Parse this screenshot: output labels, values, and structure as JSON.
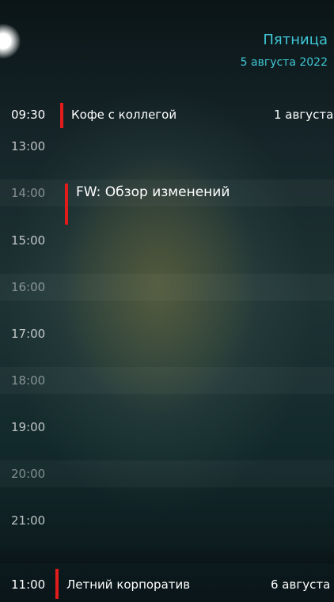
{
  "header": {
    "day": "Пятница",
    "date": "5 августа 2022"
  },
  "top_event": {
    "time": "09:30",
    "title": "Кофе с коллегой",
    "date": "1 августа",
    "color": "#e21b1b"
  },
  "inline_event": {
    "title": "FW: Обзор изменений",
    "color": "#e21b1b"
  },
  "hours": [
    "13:00",
    "14:00",
    "15:00",
    "16:00",
    "17:00",
    "18:00",
    "19:00",
    "20:00",
    "21:00"
  ],
  "bottom_event": {
    "time": "11:00",
    "title": "Летний корпоратив",
    "date": "6 августа",
    "color": "#e21b1b"
  },
  "accent_color": "#3ec7d6"
}
